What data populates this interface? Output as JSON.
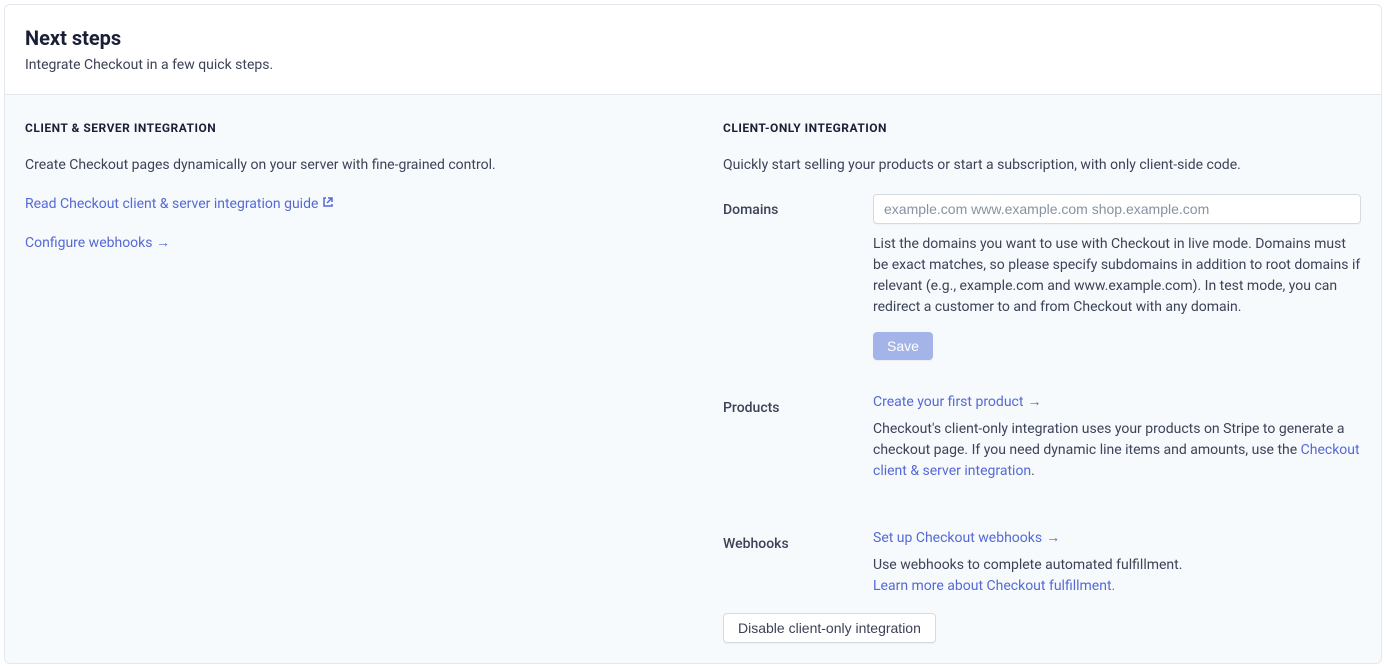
{
  "header": {
    "title": "Next steps",
    "subtitle": "Integrate Checkout in a few quick steps."
  },
  "left": {
    "heading": "CLIENT & SERVER INTEGRATION",
    "desc": "Create Checkout pages dynamically on your server with fine-grained control.",
    "link_guide": "Read Checkout client & server integration guide",
    "link_webhooks": "Configure webhooks"
  },
  "right": {
    "heading": "CLIENT-ONLY INTEGRATION",
    "desc": "Quickly start selling your products or start a subscription, with only client-side code.",
    "domains": {
      "label": "Domains",
      "placeholder": "example.com www.example.com shop.example.com",
      "help": "List the domains you want to use with Checkout in live mode. Domains must be exact matches, so please specify subdomains in addition to root domains if relevant (e.g., example.com and www.example.com). In test mode, you can redirect a customer to and from Checkout with any domain.",
      "save_label": "Save"
    },
    "products": {
      "label": "Products",
      "link_create": "Create your first product",
      "help_prefix": "Checkout's client-only integration uses your products on Stripe to generate a checkout page. If you need dynamic line items and amounts, use the ",
      "help_link": "Checkout client & server integration",
      "help_suffix": "."
    },
    "webhooks": {
      "label": "Webhooks",
      "link_setup": "Set up Checkout webhooks",
      "help": "Use webhooks to complete automated fulfillment.",
      "link_learn": "Learn more about Checkout fulfillment."
    },
    "disable_label": "Disable client-only integration"
  }
}
